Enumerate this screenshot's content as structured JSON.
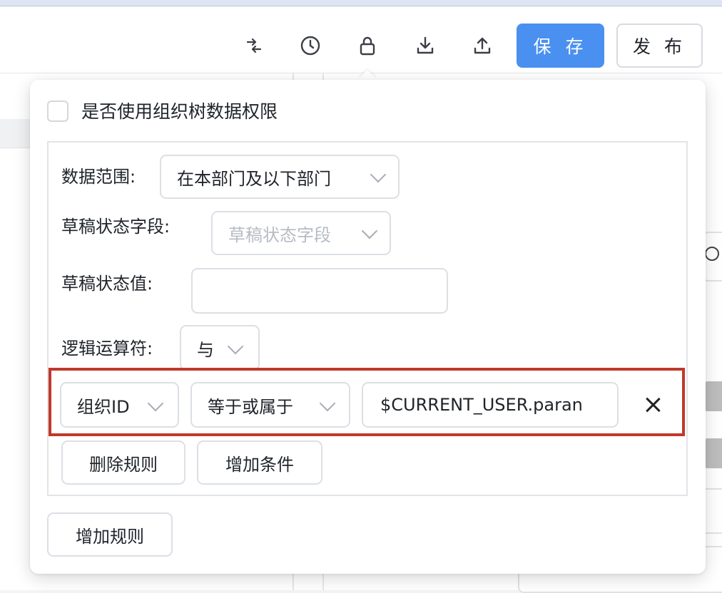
{
  "toolbar": {
    "icons": [
      "collapse-icon",
      "history-icon",
      "lock-icon",
      "download-icon",
      "upload-icon"
    ],
    "save_label": "保 存",
    "publish_label": "发 布",
    "accent_color": "#4a90f0"
  },
  "popover": {
    "checkbox_label": "是否使用组织树数据权限",
    "checkbox_checked": false,
    "rule": {
      "scope_label": "数据范围:",
      "scope_value": "在本部门及以下部门",
      "draft_field_label": "草稿状态字段:",
      "draft_field_placeholder": "草稿状态字段",
      "draft_value_label": "草稿状态值:",
      "draft_value": "",
      "logic_label": "逻辑运算符:",
      "logic_value": "与",
      "condition": {
        "field": "组织ID",
        "operator": "等于或属于",
        "value": "$CURRENT_USER.paran"
      },
      "delete_rule_label": "删除规则",
      "add_condition_label": "增加条件"
    },
    "add_rule_label": "增加规则"
  },
  "highlight_color": "#c0392b"
}
